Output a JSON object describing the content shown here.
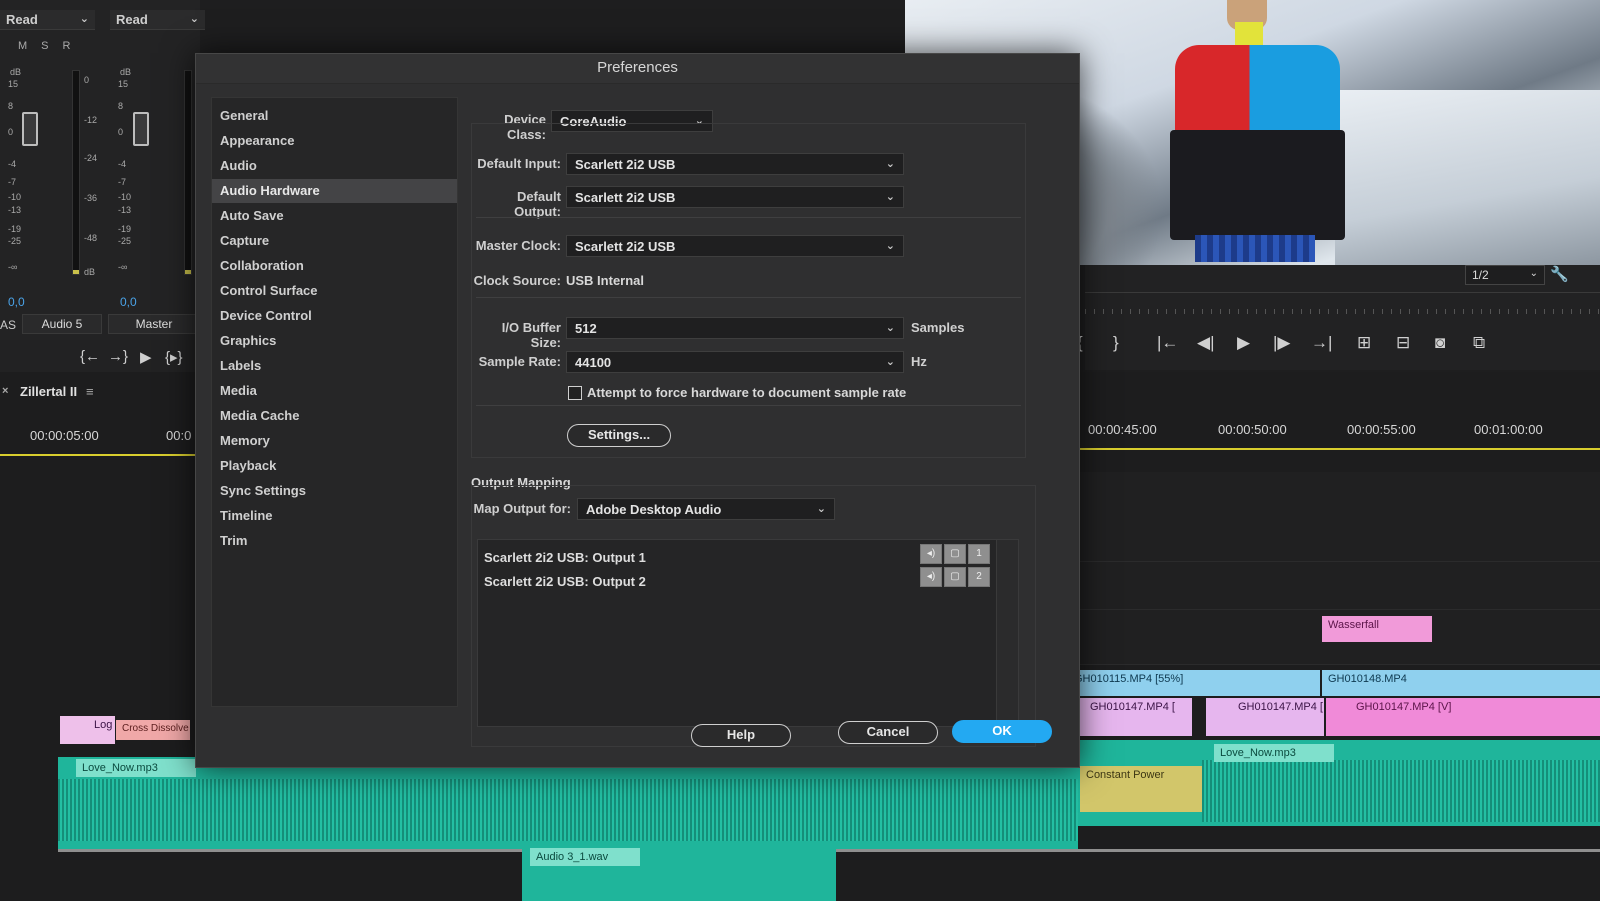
{
  "mixer": {
    "ch1_mode": "Read",
    "ch2_mode": "Read",
    "msr": [
      "M",
      "S",
      "R"
    ],
    "db_label": "dB",
    "scale_left": [
      "15",
      "8",
      "0",
      "-4",
      "-7",
      "-10",
      "-13",
      "-19",
      "-25",
      "-∞"
    ],
    "scale_mid": [
      "0",
      "-12",
      "-24",
      "-36",
      "-48",
      "dB"
    ],
    "ch1_value": "0,0",
    "ch2_value": "0,0",
    "partial_label": "AS",
    "ch1_name": "Audio 5",
    "ch2_name": "Master"
  },
  "monitor": {
    "zoom": "1/2"
  },
  "timeline": {
    "sequence_name": "Zillertal II",
    "time_left": "00:00:05:00",
    "time_left_partial": "00:0",
    "times": [
      "00:00:45:00",
      "00:00:50:00",
      "00:00:55:00",
      "00:01:00:00"
    ],
    "clips": {
      "log": "Log",
      "cross_dissolve": "Cross Dissolve",
      "love_now_1": "Love_Now.mp3",
      "love_now_2": "Love_Now.mp3",
      "audio3": "Audio 3_1.wav",
      "wasserfall": "Wasserfall",
      "gh115": "GH010115.MP4 [55%]",
      "gh148": "GH010148.MP4",
      "gh147a": "GH010147.MP4 [",
      "gh147b": "GH010147.MP4 [",
      "gh147v": "GH010147.MP4 [V]",
      "constant_power": "Constant Power",
      "fx_badge": "fx"
    }
  },
  "dialog": {
    "title": "Preferences",
    "nav": [
      "General",
      "Appearance",
      "Audio",
      "Audio Hardware",
      "Auto Save",
      "Capture",
      "Collaboration",
      "Control Surface",
      "Device Control",
      "Graphics",
      "Labels",
      "Media",
      "Media Cache",
      "Memory",
      "Playback",
      "Sync Settings",
      "Timeline",
      "Trim"
    ],
    "selected_index": 3,
    "device_class_label": "Device Class:",
    "device_class_value": "CoreAudio",
    "default_input_label": "Default Input:",
    "default_input_value": "Scarlett 2i2 USB",
    "default_output_label": "Default Output:",
    "default_output_value": "Scarlett 2i2 USB",
    "master_clock_label": "Master Clock:",
    "master_clock_value": "Scarlett 2i2 USB",
    "clock_source_label": "Clock Source:",
    "clock_source_value": "USB Internal",
    "buffer_label": "I/O Buffer Size:",
    "buffer_value": "512",
    "buffer_unit": "Samples",
    "rate_label": "Sample Rate:",
    "rate_value": "44100",
    "rate_unit": "Hz",
    "force_rate_label": "Attempt to force hardware to document sample rate",
    "force_rate_checked": false,
    "settings_button": "Settings...",
    "output_mapping_title": "Output Mapping",
    "map_output_label": "Map Output for:",
    "map_output_value": "Adobe Desktop Audio",
    "outputs": [
      {
        "device": "Scarlett 2i2 USB:",
        "channel": "Output 1",
        "num": "1"
      },
      {
        "device": "Scarlett 2i2 USB:",
        "channel": "Output 2",
        "num": "2"
      }
    ],
    "help_button": "Help",
    "cancel_button": "Cancel",
    "ok_button": "OK"
  },
  "colors": {
    "accent": "#23a9f2",
    "playhead": "#d8cd2e",
    "audio_clip": "#1fb59b",
    "video_clip": "#8fd0ee",
    "pink_clip": "#f08ad8"
  }
}
